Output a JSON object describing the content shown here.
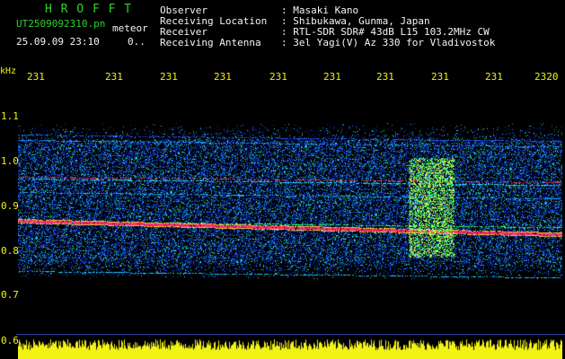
{
  "header": {
    "title": "H R O F F T",
    "filename": "UT2509092310.pn",
    "filename_suffix": "meteor",
    "datetime": "25.09.09 23:10",
    "flag": "0..",
    "observer_label": "Observer",
    "observer_value": ": Masaki Kano",
    "location_label": "Receiving Location",
    "location_value": ": Shibukawa, Gunma, Japan",
    "receiver_label": "Receiver",
    "receiver_value": ": RTL-SDR SDR# 43dB L15 103.2MHz CW",
    "antenna_label": "Receiving Antenna",
    "antenna_value": ": 3el Yagi(V) Az 330 for Vladivostok"
  },
  "axis": {
    "y_unit": "kHz",
    "y_ticks": [
      "1.1",
      "1.0",
      "0.9",
      "0.8",
      "0.7",
      "0.6"
    ],
    "x_ticks": [
      "231",
      "231",
      "231",
      "231",
      "231",
      "231",
      "231",
      "231",
      "231",
      "2320"
    ]
  },
  "colors": {
    "background": "#000000",
    "title_green": "#2fd12f",
    "axis_yellow": "#f2f215",
    "text_white": "#f4f4f4",
    "signal_red": "#ff2d6a",
    "noise_blue": "#1030d8",
    "noise_cyan": "#20d8ff",
    "noise_green": "#35ff55"
  }
}
